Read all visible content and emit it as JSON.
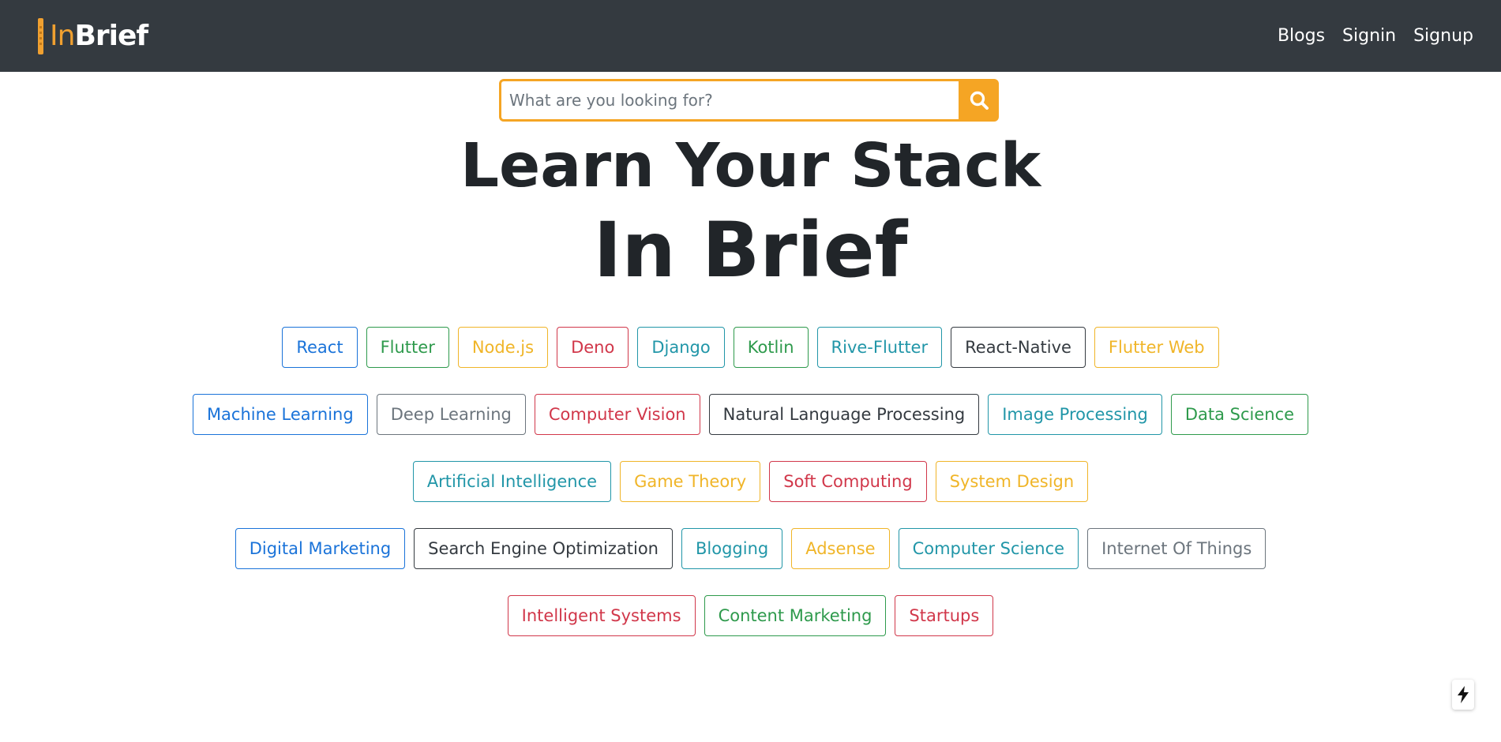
{
  "brand": {
    "part1": "In",
    "part2": "Brief"
  },
  "nav": {
    "links": [
      "Blogs",
      "Signin",
      "Signup"
    ]
  },
  "search": {
    "placeholder": "What are you looking for?",
    "value": "",
    "icon": "search-icon"
  },
  "hero": {
    "line1": "Learn Your Stack",
    "line2": "In Brief"
  },
  "colors": {
    "navbar": "#343a40",
    "accent": "#f5a524",
    "primary": "#1a73d9",
    "success": "#2e9a4c",
    "warning": "#f0b528",
    "danger": "#d1374a",
    "info": "#2196a8",
    "dark": "#343a40",
    "secondary": "#6c757d"
  },
  "tag_rows": [
    [
      {
        "label": "React",
        "variant": "primary"
      },
      {
        "label": "Flutter",
        "variant": "success"
      },
      {
        "label": "Node.js",
        "variant": "warning"
      },
      {
        "label": "Deno",
        "variant": "danger"
      },
      {
        "label": "Django",
        "variant": "info"
      },
      {
        "label": "Kotlin",
        "variant": "success"
      },
      {
        "label": "Rive-Flutter",
        "variant": "info"
      },
      {
        "label": "React-Native",
        "variant": "dark"
      },
      {
        "label": "Flutter Web",
        "variant": "warning"
      }
    ],
    [
      {
        "label": "Machine Learning",
        "variant": "primary"
      },
      {
        "label": "Deep Learning",
        "variant": "secondary"
      },
      {
        "label": "Computer Vision",
        "variant": "danger"
      },
      {
        "label": "Natural Language Processing",
        "variant": "dark"
      },
      {
        "label": "Image Processing",
        "variant": "info"
      },
      {
        "label": "Data Science",
        "variant": "success"
      }
    ],
    [
      {
        "label": "Artificial Intelligence",
        "variant": "info"
      },
      {
        "label": "Game Theory",
        "variant": "warning"
      },
      {
        "label": "Soft Computing",
        "variant": "danger"
      },
      {
        "label": "System Design",
        "variant": "warning"
      }
    ],
    [
      {
        "label": "Digital Marketing",
        "variant": "primary"
      },
      {
        "label": "Search Engine Optimization",
        "variant": "dark"
      },
      {
        "label": "Blogging",
        "variant": "info"
      },
      {
        "label": "Adsense",
        "variant": "warning"
      },
      {
        "label": "Computer Science",
        "variant": "info"
      },
      {
        "label": "Internet Of Things",
        "variant": "secondary"
      }
    ],
    [
      {
        "label": "Intelligent Systems",
        "variant": "danger"
      },
      {
        "label": "Content Marketing",
        "variant": "success"
      },
      {
        "label": "Startups",
        "variant": "danger"
      }
    ]
  ],
  "fab": {
    "icon": "lightning-icon"
  }
}
